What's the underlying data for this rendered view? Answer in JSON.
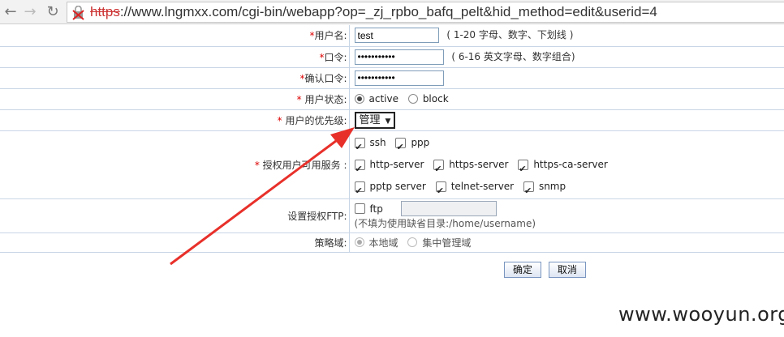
{
  "browser": {
    "url_scheme": "https",
    "url_rest": "://www.lngmxx.com/cgi-bin/webapp?op=_zj_rpbo_bafq_pelt&hid_method=edit&userid=4"
  },
  "form": {
    "username": {
      "required": "*",
      "label": "用户名:",
      "value": "test",
      "hint": "( 1-20 字母、数字、下划线 )"
    },
    "password": {
      "required": "*",
      "label": "口令:",
      "value": "•••••••••••",
      "hint": "( 6-16 英文字母、数字组合)"
    },
    "confirm": {
      "required": "*",
      "label": "确认口令:",
      "value": "•••••••••••"
    },
    "status": {
      "required": "*",
      "label": " 用户状态:",
      "options": [
        "active",
        "block"
      ],
      "selected": "active"
    },
    "priority": {
      "required": "*",
      "label": " 用户的优先级:",
      "value": "管理"
    },
    "services": {
      "required": "*",
      "label": " 授权用户可用服务 :",
      "rows": [
        [
          "ssh",
          "ppp"
        ],
        [
          "http-server",
          "https-server",
          "https-ca-server"
        ],
        [
          "pptp server",
          "telnet-server",
          "snmp"
        ]
      ]
    },
    "ftp": {
      "label": "设置授权FTP:",
      "option": "ftp",
      "note": "(不填为使用缺省目录:/home/username)"
    },
    "domain": {
      "label": "策略域:",
      "options": [
        "本地域",
        "集中管理域"
      ],
      "selected": "本地域"
    },
    "buttons": {
      "ok": "确定",
      "cancel": "取消"
    }
  },
  "watermark": "www.wooyun.org",
  "colors": {
    "border": "#c8d5e6",
    "required": "#dd0000",
    "arrow": "#e8302a"
  }
}
